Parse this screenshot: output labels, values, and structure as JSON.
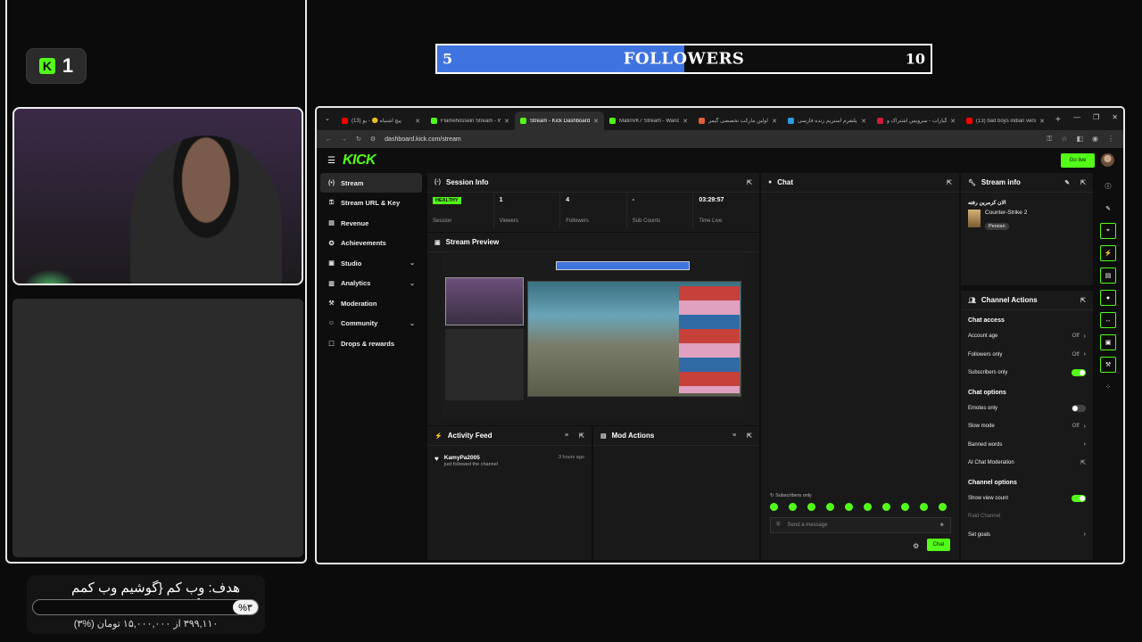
{
  "overlay": {
    "kick_count": "1",
    "followers": {
      "current": "5",
      "label": "FOLLOWERS",
      "target": "10",
      "progress_fraction": 0.5
    },
    "goal": {
      "title": "هدف: وب کم {گوشیم وب کمم هستش}",
      "percent_label": "%۳",
      "subtitle": "۳۹۹,۱۱۰ از ۱۵,۰۰۰,۰۰۰ تومان (%۳)",
      "progress_fraction": 0.03
    }
  },
  "browser": {
    "tabs": [
      {
        "title": "(13) پیچ اشتباه 🙁 - یو",
        "color": "#ff0000",
        "active": false
      },
      {
        "title": "Flamehossein Stream - W",
        "color": "#53fc18",
        "active": false
      },
      {
        "title": "Stream - Kick Dashboard",
        "color": "#53fc18",
        "active": true
      },
      {
        "title": "MatinVK7 Stream - Wand",
        "color": "#53fc18",
        "active": false
      },
      {
        "title": "اولین مارکت تخصصی گیمر",
        "color": "#e0603a",
        "active": false
      },
      {
        "title": "پلتفرم استریم زنده فارسی",
        "color": "#2a9de0",
        "active": false
      },
      {
        "title": "گیارات - سرویس اشتراک و",
        "color": "#d01a3a",
        "active": false
      },
      {
        "title": "(13) bad boys indian vers",
        "color": "#ff0000",
        "active": false
      }
    ],
    "url": "dashboard.kick.com/stream"
  },
  "app": {
    "brand": "KICK",
    "go_live": "Go live",
    "nav": [
      {
        "label": "Stream",
        "icon": "(•)",
        "active": true,
        "chevron": false
      },
      {
        "label": "Stream URL & Key",
        "icon": "⚿",
        "active": false,
        "chevron": false
      },
      {
        "label": "Revenue",
        "icon": "▤",
        "active": false,
        "chevron": false
      },
      {
        "label": "Achievements",
        "icon": "✪",
        "active": false,
        "chevron": false
      },
      {
        "label": "Studio",
        "icon": "▣",
        "active": false,
        "chevron": true
      },
      {
        "label": "Analytics",
        "icon": "▥",
        "active": false,
        "chevron": true
      },
      {
        "label": "Moderation",
        "icon": "⚒",
        "active": false,
        "chevron": false
      },
      {
        "label": "Community",
        "icon": "☺",
        "active": false,
        "chevron": true
      },
      {
        "label": "Drops & rewards",
        "icon": "⬚",
        "active": false,
        "chevron": false
      }
    ],
    "session": {
      "title": "Session Info",
      "health": "HEALTHY",
      "health_label": "Session",
      "stats": [
        {
          "value": "1",
          "label": "Viewers"
        },
        {
          "value": "4",
          "label": "Followers"
        },
        {
          "value": "-",
          "label": "Sub Counts"
        },
        {
          "value": "03:29:57",
          "label": "Time Live"
        }
      ]
    },
    "preview": {
      "title": "Stream Preview"
    },
    "activity": {
      "title": "Activity Feed",
      "items": [
        {
          "user": "KamyPa2005",
          "action": "just followed the channel",
          "time": "3 hours ago"
        }
      ]
    },
    "mod_actions": {
      "title": "Mod Actions"
    },
    "chat": {
      "title": "Chat",
      "mode": "Subscribers only",
      "placeholder": "Send a message",
      "send": "Chat"
    },
    "stream_info": {
      "title": "Stream info",
      "stream_title": "الان کرمرین رفته",
      "category": "Counter-Strike 2",
      "tag": "Persian"
    },
    "channel_actions": {
      "title": "Channel Actions",
      "chat_access": {
        "heading": "Chat access",
        "rows": [
          {
            "label": "Account age",
            "value": "Off",
            "type": "chevron"
          },
          {
            "label": "Followers only",
            "value": "Off",
            "type": "chevron"
          },
          {
            "label": "Subscribers only",
            "value": "",
            "type": "toggle-on"
          }
        ]
      },
      "chat_options": {
        "heading": "Chat options",
        "rows": [
          {
            "label": "Emotes only",
            "value": "",
            "type": "toggle-off"
          },
          {
            "label": "Slow mode",
            "value": "Off",
            "type": "chevron"
          },
          {
            "label": "Banned words",
            "value": "",
            "type": "chevron"
          },
          {
            "label": "AI Chat Moderation",
            "value": "",
            "type": "external"
          }
        ]
      },
      "channel_options": {
        "heading": "Channel options",
        "rows": [
          {
            "label": "Show view count",
            "value": "",
            "type": "toggle-on"
          },
          {
            "label": "Raid Channel",
            "value": "",
            "type": "dim"
          },
          {
            "label": "Set goals",
            "value": "",
            "type": "chevron"
          }
        ]
      }
    },
    "colors": {
      "accent": "#53fc18",
      "follower_bar": "#3f73e0",
      "panel": "#191919"
    }
  }
}
